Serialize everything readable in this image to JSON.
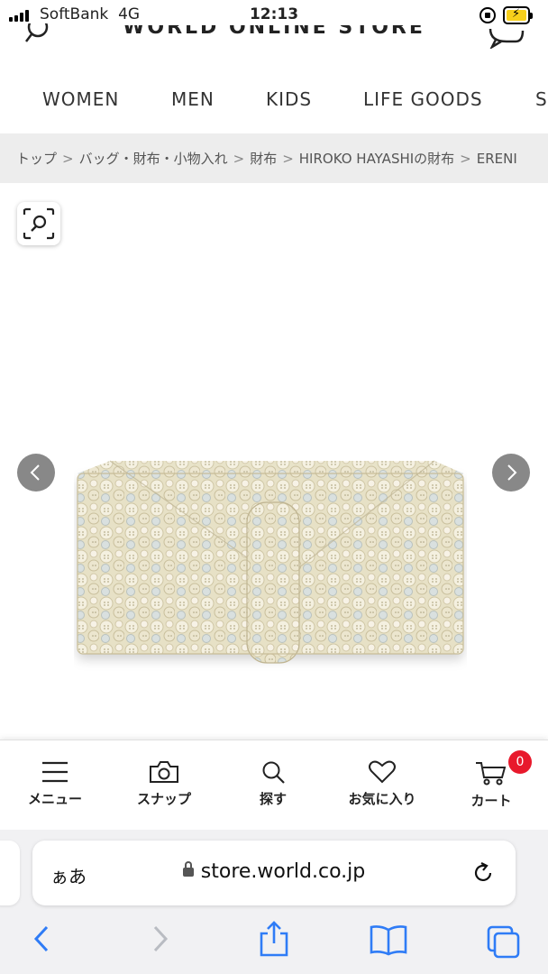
{
  "status": {
    "carrier": "SoftBank",
    "network": "4G",
    "time": "12:13"
  },
  "header": {
    "brand": "WORLD ONLINE STORE",
    "categories": [
      "WOMEN",
      "MEN",
      "KIDS",
      "LIFE GOODS",
      "S"
    ]
  },
  "breadcrumb": [
    "トップ",
    "バッグ・財布・小物入れ",
    "財布",
    "HIROKO HAYASHIの財布",
    "ERENI"
  ],
  "breadcrumb_sep": ">",
  "product": {
    "image_icon": "button-pattern-wallet-image"
  },
  "bottom_nav": {
    "items": [
      {
        "label": "メニュー",
        "icon": "hamburger-menu-icon"
      },
      {
        "label": "スナップ",
        "icon": "camera-icon"
      },
      {
        "label": "探す",
        "icon": "search-icon"
      },
      {
        "label": "お気に入り",
        "icon": "heart-icon"
      },
      {
        "label": "カート",
        "icon": "cart-icon"
      }
    ],
    "cart_count": "0"
  },
  "safari": {
    "aa": "ぁあ",
    "url": "store.world.co.jp"
  },
  "colors": {
    "badge": "#e8192c",
    "battery": "#f7cf1b",
    "safari_blue": "#2f7cf6",
    "arrow_bg": "#888888"
  }
}
